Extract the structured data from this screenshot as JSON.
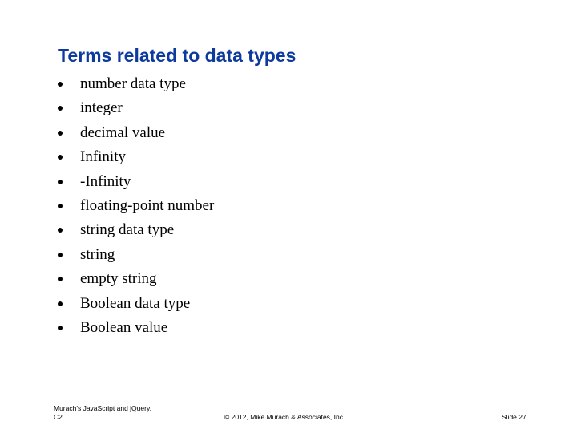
{
  "slide": {
    "title": "Terms related to data types",
    "bullets": [
      "number data type",
      "integer",
      "decimal value",
      "Infinity",
      "-Infinity",
      "floating-point number",
      "string data type",
      "string",
      "empty string",
      "Boolean data type",
      "Boolean value"
    ]
  },
  "footer": {
    "book_line1": "Murach's JavaScript and jQuery,",
    "book_line2": "C2",
    "copyright": "© 2012, Mike Murach & Associates, Inc.",
    "slide_number": "Slide 27"
  },
  "colors": {
    "title": "#0e3a9e",
    "body_text": "#000000"
  }
}
